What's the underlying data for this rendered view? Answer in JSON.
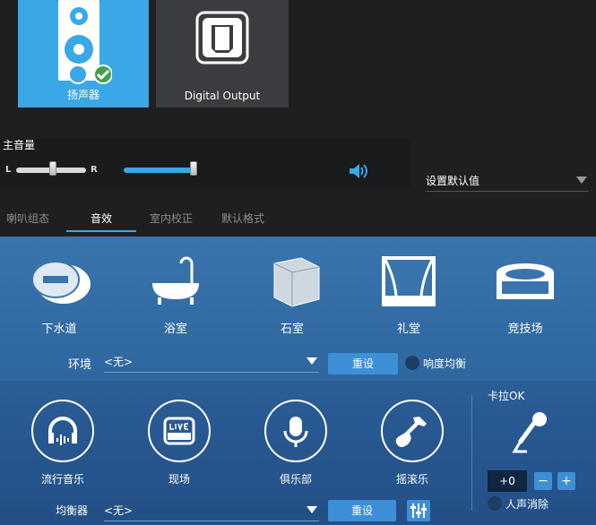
{
  "devices": [
    {
      "label": "扬声器",
      "selected": true,
      "icon": "speaker-cabinet-icon"
    },
    {
      "label": "Digital Output",
      "selected": false,
      "icon": "digital-output-icon"
    }
  ],
  "volume": {
    "title": "主音量",
    "left_label": "L",
    "right_label": "R",
    "balance": 0.5,
    "level": 0.85
  },
  "default_select": {
    "value": "设置默认值"
  },
  "tabs": [
    {
      "label": "喇叭组态",
      "active": false
    },
    {
      "label": "音效",
      "active": true
    },
    {
      "label": "室内校正",
      "active": false
    },
    {
      "label": "默认格式",
      "active": false
    }
  ],
  "environment": {
    "items": [
      {
        "label": "下水道",
        "icon": "sewer-pipe-icon"
      },
      {
        "label": "浴室",
        "icon": "bathtub-icon"
      },
      {
        "label": "石室",
        "icon": "stone-room-icon"
      },
      {
        "label": "礼堂",
        "icon": "auditorium-icon"
      },
      {
        "label": "竞技场",
        "icon": "arena-icon"
      }
    ],
    "label": "环境",
    "value": "<无>",
    "reset_label": "重设",
    "loudness_label": "响度均衡"
  },
  "equalizer": {
    "items": [
      {
        "label": "流行音乐",
        "icon": "headphones-icon"
      },
      {
        "label": "现场",
        "icon": "live-music-icon"
      },
      {
        "label": "俱乐部",
        "icon": "microphone-icon"
      },
      {
        "label": "摇滚乐",
        "icon": "guitar-icon"
      }
    ],
    "label": "均衡器",
    "value": "<无>",
    "reset_label": "重设"
  },
  "karaoke": {
    "title": "卡拉OK",
    "value": "+0",
    "minus": "−",
    "plus": "+",
    "voice_cancel_label": "人声消除"
  },
  "colors": {
    "accent": "#3aa7e6",
    "panel_blue": "#3a74ad",
    "button_blue": "#3d8fd6"
  }
}
